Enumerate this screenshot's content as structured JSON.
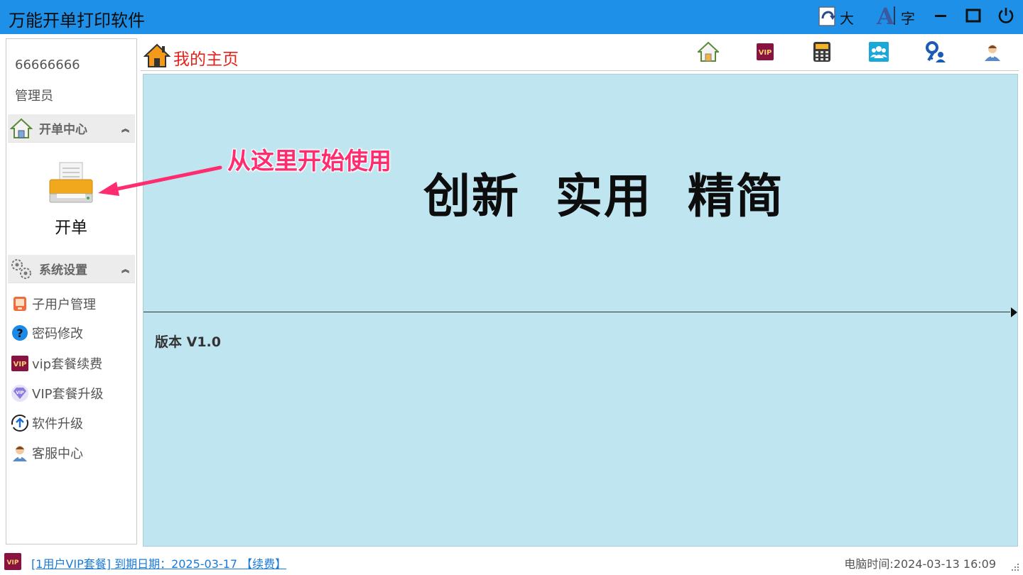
{
  "window": {
    "title": "万能开单打印软件",
    "btn_large_label": "大",
    "btn_font_label": "字"
  },
  "sidebar": {
    "user_id": "66666666",
    "user_role": "管理员",
    "section1": {
      "label": "开单中心",
      "icon": "house-icon"
    },
    "kaidan_label": "开单",
    "section2": {
      "label": "系统设置",
      "icon": "gears-icon"
    },
    "items": [
      {
        "label": "子用户管理",
        "icon": "sub-user-icon"
      },
      {
        "label": "密码修改",
        "icon": "question-icon"
      },
      {
        "label": "vip套餐续费",
        "icon": "vip-badge-icon"
      },
      {
        "label": "VIP套餐升级",
        "icon": "vip-diamond-icon"
      },
      {
        "label": "软件升级",
        "icon": "upgrade-icon"
      },
      {
        "label": "客服中心",
        "icon": "support-agent-icon"
      }
    ]
  },
  "header": {
    "home_label": "我的主页"
  },
  "main": {
    "slogan": "创新  实用  精简",
    "version": "版本 V1.0"
  },
  "annotation": {
    "text": "从这里开始使用"
  },
  "status": {
    "vip_link": "[1用户VIP套餐] 到期日期：2025-03-17 【续费】",
    "clock": "电脑时间:2024-03-13 16:09"
  },
  "colors": {
    "titlebar": "#1e90e8",
    "panel": "#bfe6f0",
    "home_title": "#e8201a",
    "annotation": "#ff2d70",
    "link": "#1a7ad8"
  }
}
